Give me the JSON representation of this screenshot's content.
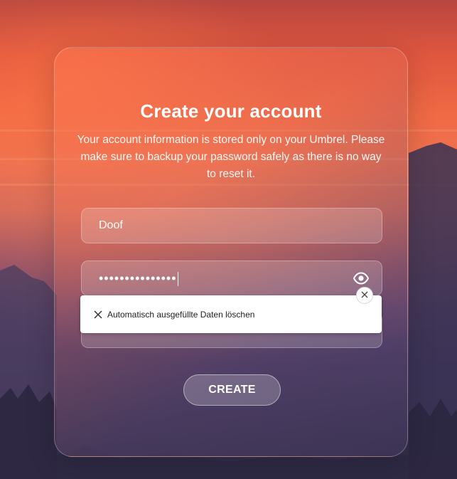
{
  "signup": {
    "title": "Create your account",
    "description": "Your account information is stored only on your Umbrel. Please make sure to backup your password safely as there is no way to reset it.",
    "name_value": "Doof",
    "password_masked": "•••••••••••••••",
    "create_label": "CREATE"
  },
  "autofill": {
    "clear_label": "Automatisch ausgefüllte Daten löschen"
  },
  "icons": {
    "password_toggle": "eye-icon",
    "clear": "close-icon"
  }
}
